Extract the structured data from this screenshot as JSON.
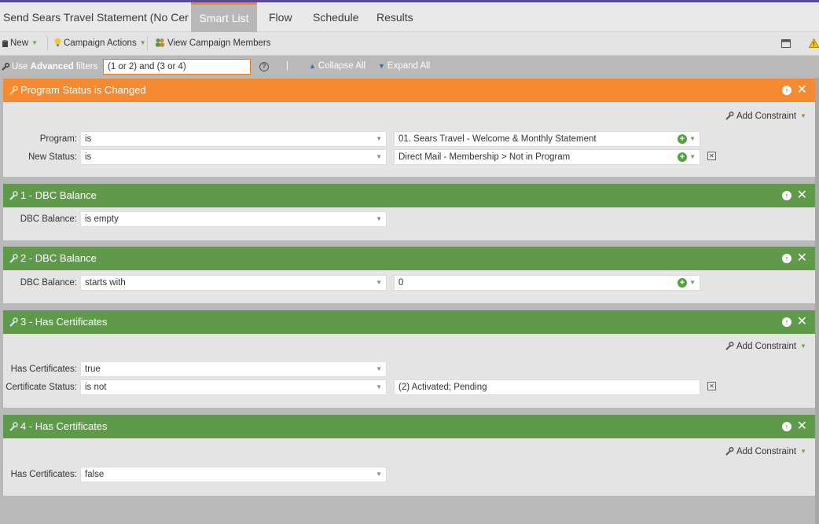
{
  "tabs": {
    "campaign": "Send Sears Travel Statement (No Cert/...",
    "smart_list": "Smart List",
    "flow": "Flow",
    "schedule": "Schedule",
    "results": "Results"
  },
  "toolbar": {
    "new_label": "New",
    "campaign_actions_label": "Campaign Actions",
    "view_members_label": "View Campaign Members"
  },
  "filterbar": {
    "use_label": "Use",
    "advanced_label": "Advanced",
    "filters_label": "filters",
    "logic_value": "(1 or 2) and (3 or 4)",
    "separator": "|",
    "collapse_all": "Collapse All",
    "expand_all": "Expand All"
  },
  "colors": {
    "trigger": "#f58a33",
    "filter": "#5e9a4a",
    "accent": "#f08830"
  },
  "filters": [
    {
      "title": "Program Status is Changed",
      "add_constraint": "Add Constraint",
      "rows": [
        {
          "label": "Program:",
          "operator": "is",
          "value": "01. Sears Travel - Welcome & Monthly Statement"
        },
        {
          "label": "New Status:",
          "operator": "is",
          "value": "Direct Mail - Membership > Not in Program"
        }
      ]
    },
    {
      "title": "1 - DBC Balance",
      "rows": [
        {
          "label": "DBC Balance:",
          "operator": "is empty"
        }
      ]
    },
    {
      "title": "2 - DBC Balance",
      "rows": [
        {
          "label": "DBC Balance:",
          "operator": "starts with",
          "value": "0"
        }
      ]
    },
    {
      "title": "3 - Has Certificates",
      "add_constraint": "Add Constraint",
      "rows": [
        {
          "label": "Has Certificates:",
          "operator": "true"
        },
        {
          "label": "Certificate Status:",
          "operator": "is not",
          "value": "(2) Activated; Pending"
        }
      ]
    },
    {
      "title": "4 - Has Certificates",
      "add_constraint": "Add Constraint",
      "rows": [
        {
          "label": "Has Certificates:",
          "operator": "false"
        }
      ]
    }
  ]
}
